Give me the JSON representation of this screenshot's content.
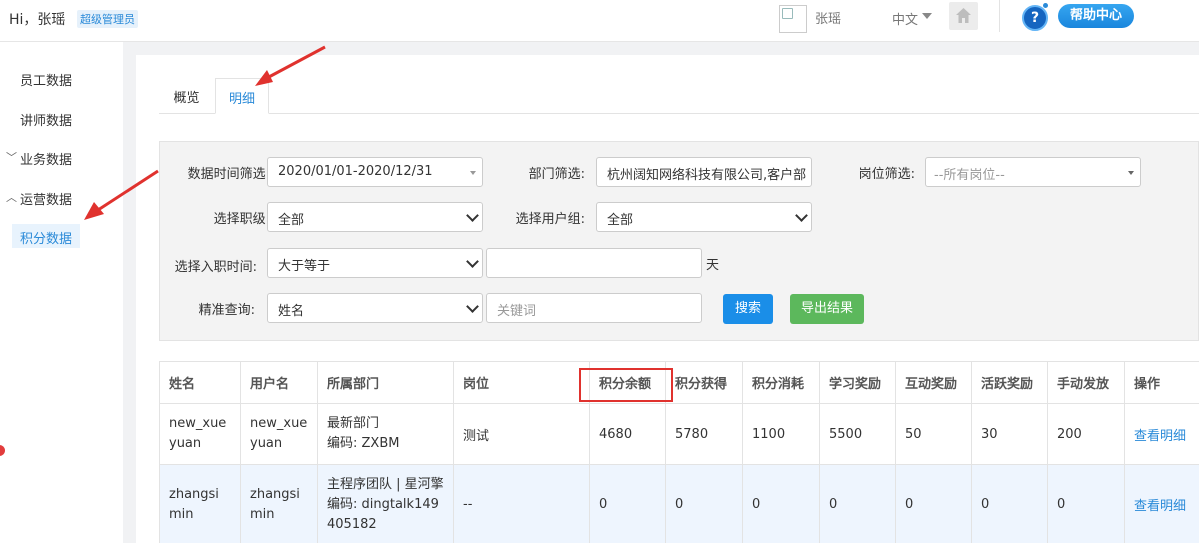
{
  "header": {
    "greeting": "Hi，张瑶",
    "role_badge": "超级管理员",
    "username": "张瑶",
    "language": "中文",
    "help_icon": "?",
    "help_label": "帮助中心"
  },
  "sidebar": {
    "items": [
      {
        "label": "员工数据"
      },
      {
        "label": "讲师数据"
      },
      {
        "label": "业务数据",
        "arrow": "﹀"
      },
      {
        "label": "运营数据",
        "arrow": "︿"
      },
      {
        "label": "积分数据"
      }
    ]
  },
  "tabs": [
    "概览",
    "明细"
  ],
  "filters": {
    "time_label": "数据时间筛选:",
    "time_value": "2020/01/01-2020/12/31",
    "dept_label": "部门筛选:",
    "dept_value": "杭州阔知网络科技有限公司,客户部",
    "post_label": "岗位筛选:",
    "post_value": "--所有岗位--",
    "rank_label": "选择职级:",
    "rank_value": "全部",
    "group_label": "选择用户组:",
    "group_value": "全部",
    "hire_label": "选择入职时间:",
    "hire_value": "大于等于",
    "hire_days": "",
    "hire_unit": "天",
    "query_label": "精准查询:",
    "query_value": "姓名",
    "keyword_placeholder": "关键词",
    "search_btn": "搜索",
    "export_btn": "导出结果"
  },
  "table": {
    "headers": [
      "姓名",
      "用户名",
      "所属部门",
      "岗位",
      "积分余额",
      "积分获得",
      "积分消耗",
      "学习奖励",
      "互动奖励",
      "活跃奖励",
      "手动发放",
      "操作"
    ],
    "rows": [
      {
        "name": "new_xueyuan",
        "username": "new_xueyuan",
        "dept_name": "最新部门",
        "dept_code": "编码:  ZXBM",
        "post": "测试",
        "balance": "4680",
        "earned": "5780",
        "consumed": "1100",
        "study": "5500",
        "interact": "50",
        "active": "30",
        "manual": "200",
        "action": "查看明细"
      },
      {
        "name": "zhangsimin",
        "username": "zhangsimin",
        "dept_name": "主程序团队 | 星河擎天领",
        "dept_code": "编码:  dingtalk149405182",
        "post": "--",
        "balance": "0",
        "earned": "0",
        "consumed": "0",
        "study": "0",
        "interact": "0",
        "active": "0",
        "manual": "0",
        "action": "查看明细"
      }
    ]
  },
  "colors": {
    "accent": "#2a8ad8",
    "search_button": "#1a8ee8",
    "export_button": "#5cb85c",
    "highlight_red": "#e0322e"
  }
}
